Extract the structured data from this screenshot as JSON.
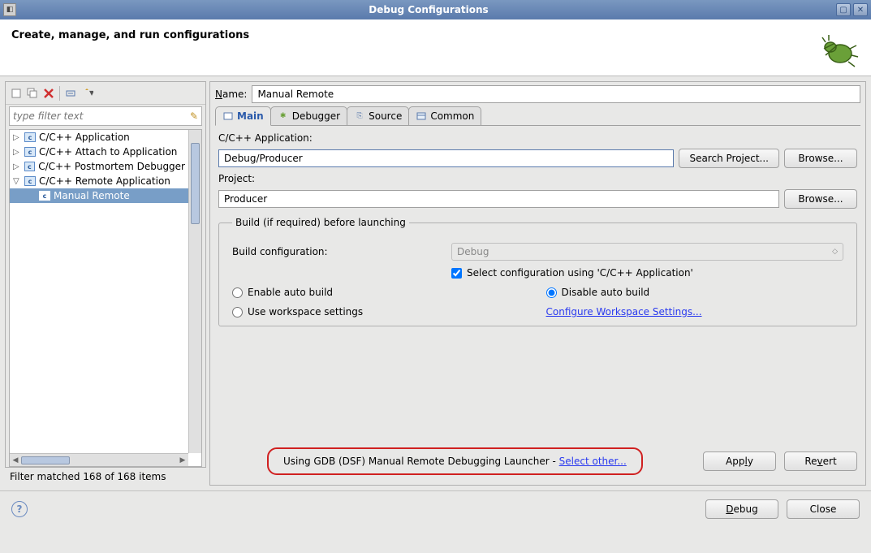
{
  "window": {
    "title": "Debug Configurations"
  },
  "header": {
    "subtitle": "Create, manage, and run configurations"
  },
  "left": {
    "filter_placeholder": "type filter text",
    "tree": [
      {
        "label": "C/C++ Application",
        "expanded": false
      },
      {
        "label": "C/C++ Attach to Application",
        "expanded": false
      },
      {
        "label": "C/C++ Postmortem Debugger",
        "expanded": false
      },
      {
        "label": "C/C++ Remote Application",
        "expanded": true,
        "children": [
          {
            "label": "Manual Remote",
            "selected": true
          }
        ]
      }
    ],
    "status": "Filter matched 168 of 168 items"
  },
  "form": {
    "name_label": "Name:",
    "name_value": "Manual Remote",
    "tabs": [
      {
        "label": "Main",
        "active": true
      },
      {
        "label": "Debugger",
        "active": false
      },
      {
        "label": "Source",
        "active": false
      },
      {
        "label": "Common",
        "active": false
      }
    ],
    "app_label": "C/C++ Application:",
    "app_value": "Debug/Producer",
    "search_project": "Search Project...",
    "browse": "Browse...",
    "project_label": "Project:",
    "project_value": "Producer",
    "build": {
      "legend": "Build (if required) before launching",
      "config_label": "Build configuration:",
      "config_value": "Debug",
      "select_using": "Select configuration using 'C/C++ Application'",
      "enable_auto": "Enable auto build",
      "disable_auto": "Disable auto build",
      "use_workspace": "Use workspace settings",
      "configure_link": "Configure Workspace Settings..."
    },
    "launcher_text": "Using GDB (DSF) Manual Remote Debugging Launcher - ",
    "launcher_link": "Select other...",
    "apply": "Apply",
    "revert": "Revert"
  },
  "bottom": {
    "debug": "Debug",
    "close": "Close"
  }
}
